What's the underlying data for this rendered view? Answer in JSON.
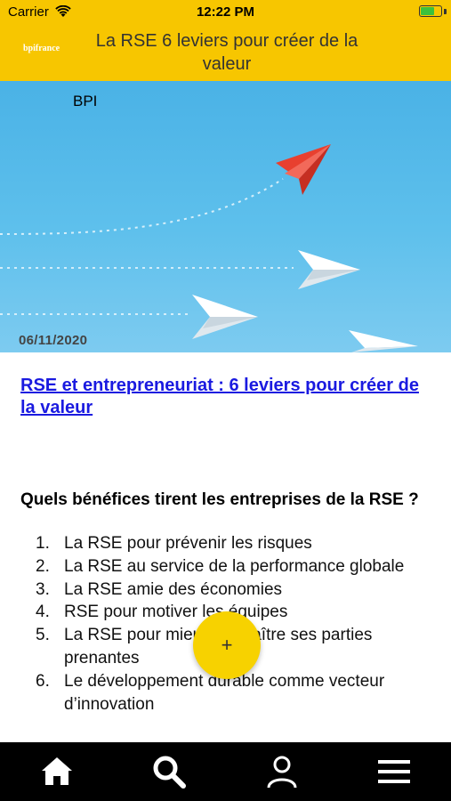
{
  "status_bar": {
    "carrier": "Carrier",
    "time": "12:22 PM",
    "battery_level": 0.7
  },
  "nav": {
    "logo_text": "bpifrance",
    "title": "La RSE 6 leviers pour créer de la valeur"
  },
  "hero": {
    "source": "BPI",
    "date": "06/11/2020"
  },
  "article": {
    "link_text": "RSE et entrepreneuriat : 6 leviers pour créer de la valeur",
    "heading": "Quels bénéfices tirent les entreprises de la RSE ?",
    "levers": [
      {
        "num": "1.",
        "text": "La RSE pour prévenir les risques"
      },
      {
        "num": "2.",
        "text": "La RSE au service de la performance globale"
      },
      {
        "num": "3.",
        "text": "La RSE amie des économies"
      },
      {
        "num": "4.",
        "text": "RSE pour motiver les équipes"
      },
      {
        "num": "5.",
        "text": "La RSE pour mieux connaître ses parties prenantes"
      },
      {
        "num": "6.",
        "text": "Le développement durable comme vecteur d’innovation"
      }
    ]
  },
  "fab": {
    "label": "+"
  },
  "tabbar": {
    "items": [
      {
        "icon": "home-icon"
      },
      {
        "icon": "search-icon"
      },
      {
        "icon": "user-icon"
      },
      {
        "icon": "menu-icon"
      }
    ]
  },
  "colors": {
    "header_bg": "#f7c600",
    "fab_bg": "#f7d200",
    "link": "#1a1ae0",
    "tabbar_bg": "#000000"
  }
}
